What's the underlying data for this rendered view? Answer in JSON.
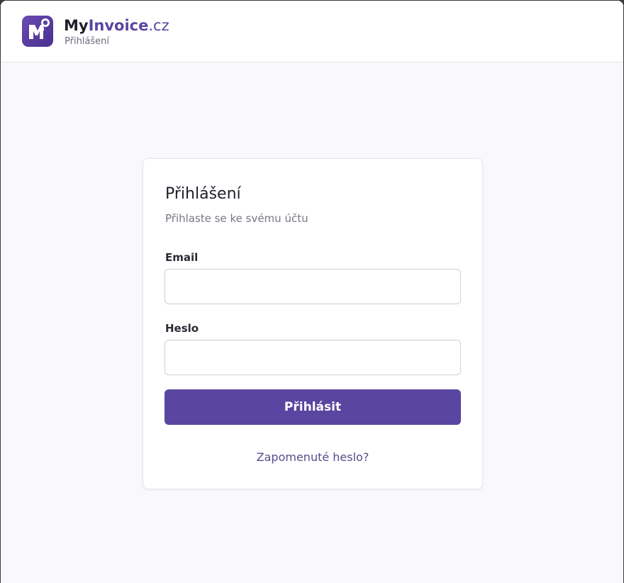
{
  "colors": {
    "accent": "#5a46a0",
    "background": "#f9f9fc",
    "card": "#ffffff",
    "text": "#1f1f2a"
  },
  "header": {
    "brand_my": "My",
    "brand_invoice": "Invoice",
    "brand_tld": ".cz",
    "subtitle": "Přihlášení",
    "logo_icon": "myinvoice-logo-icon"
  },
  "login": {
    "title": "Přihlášení",
    "subtitle": "Přihlaste se ke svému účtu",
    "email_label": "Email",
    "email_value": "",
    "password_label": "Heslo",
    "password_value": "",
    "submit_label": "Přihlásit",
    "forgot_label": "Zapomenuté heslo?"
  }
}
